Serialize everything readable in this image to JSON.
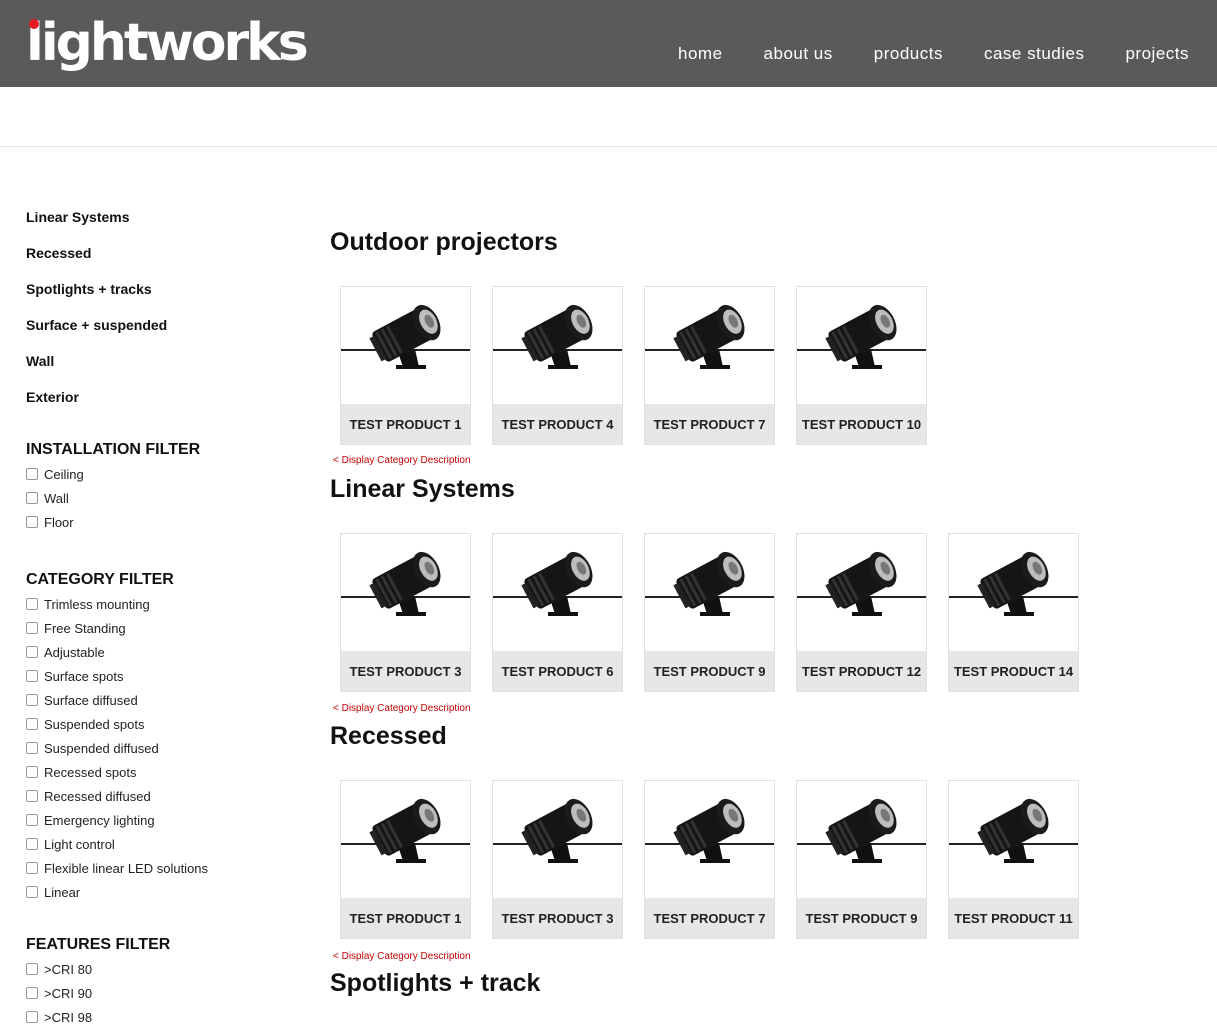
{
  "brand": {
    "name": "lightworks",
    "accent": "#e31b23",
    "header_bg": "#5a5a5a"
  },
  "nav": [
    "home",
    "about us",
    "products",
    "case studies",
    "projects"
  ],
  "sidebar": {
    "links": [
      "Linear Systems",
      "Recessed",
      "Spotlights + tracks",
      "Surface + suspended",
      "Wall",
      "Exterior"
    ]
  },
  "filters": {
    "installation": {
      "title": "INSTALLATION FILTER",
      "items": [
        "Ceiling",
        "Wall",
        "Floor"
      ]
    },
    "category": {
      "title": "CATEGORY FILTER",
      "items": [
        "Trimless mounting",
        "Free Standing",
        "Adjustable",
        "Surface spots",
        "Surface diffused",
        "Suspended spots",
        "Suspended diffused",
        "Recessed spots",
        "Recessed diffused",
        "Emergency lighting",
        "Light control",
        "Flexible linear LED solutions",
        "Linear"
      ]
    },
    "features": {
      "title": "FEATURES FILTER",
      "items": [
        ">CRI 80",
        ">CRI 90",
        ">CRI 98"
      ]
    }
  },
  "sections": [
    {
      "title": "Outdoor projectors",
      "products": [
        "TEST PRODUCT 1",
        "TEST PRODUCT 4",
        "TEST PRODUCT 7",
        "TEST PRODUCT 10"
      ],
      "desc": "< Display Category Description"
    },
    {
      "title": "Linear Systems",
      "products": [
        "TEST PRODUCT 3",
        "TEST PRODUCT 6",
        "TEST PRODUCT 9",
        "TEST PRODUCT 12",
        "TEST PRODUCT 14"
      ],
      "desc": "< Display Category Description"
    },
    {
      "title": "Recessed",
      "products": [
        "TEST PRODUCT 1",
        "TEST PRODUCT 3",
        "TEST PRODUCT 7",
        "TEST PRODUCT 9",
        "TEST PRODUCT 11"
      ],
      "desc": "< Display Category Description"
    },
    {
      "title": "Spotlights + track",
      "products": [],
      "desc": ""
    }
  ]
}
